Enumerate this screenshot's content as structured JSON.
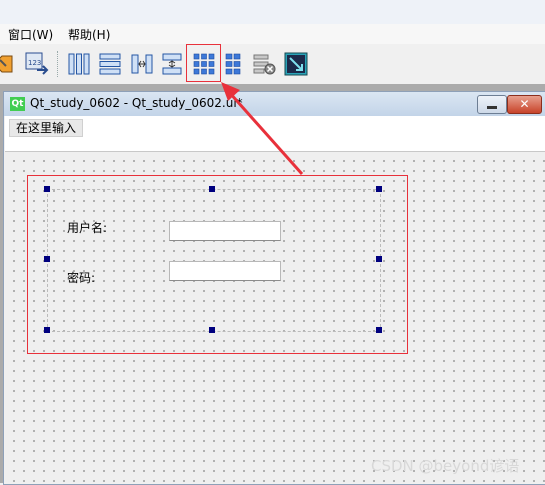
{
  "menubar": {
    "window_menu": "窗口(W)",
    "help_menu": "帮助(H)"
  },
  "toolbar": {
    "buttons": [
      "tab-order-icon",
      "buddy-editor-icon",
      "layout-horizontal-icon",
      "layout-vertical-icon",
      "splitter-horizontal-icon",
      "splitter-vertical-icon",
      "layout-grid-icon",
      "layout-form-icon",
      "break-layout-icon",
      "adjust-size-icon"
    ]
  },
  "subwindow": {
    "app_badge": "Qt",
    "title": "Qt_study_0602 - Qt_study_0602.ui*",
    "close_glyph": "✕"
  },
  "form": {
    "menu_placeholder": "在这里输入",
    "username_label": "用户名:",
    "password_label": "密码:"
  },
  "annotation": {
    "color": "#e8313b"
  },
  "watermark": "CSDN @beyond谚语"
}
